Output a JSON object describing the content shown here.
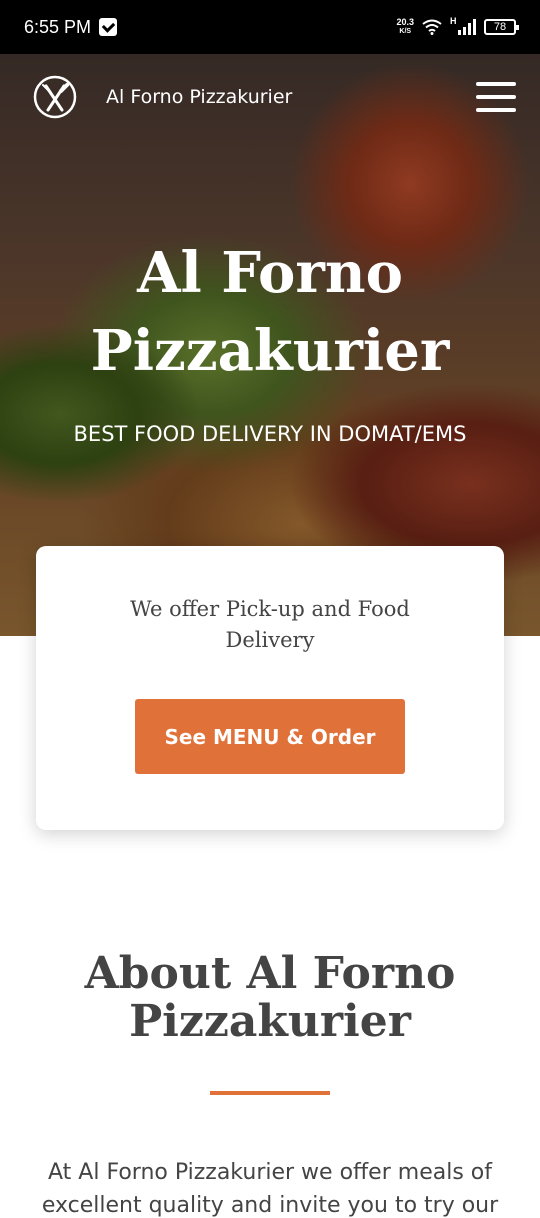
{
  "status_bar": {
    "time": "6:55 PM",
    "net_speed_value": "20.3",
    "net_speed_unit": "K/S",
    "network_type": "H",
    "battery": "78"
  },
  "navbar": {
    "brand": "Al Forno Pizzakurier",
    "logo_icon": "plate-cutlery-icon",
    "menu_icon": "hamburger-icon"
  },
  "hero": {
    "title_line1": "Al Forno",
    "title_line2": "Pizzakurier",
    "subtitle": "BEST FOOD DELIVERY IN DOMAT/EMS"
  },
  "card": {
    "text": "We offer Pick-up and Food Delivery",
    "button_label": "See MENU & Order"
  },
  "about": {
    "title_line1": "About Al Forno",
    "title_line2": "Pizzakurier",
    "text": "At Al Forno Pizzakurier we offer meals of excellent quality and invite you to try our"
  },
  "colors": {
    "accent": "#e07139",
    "text": "#444444",
    "status_bar": "#000000"
  }
}
